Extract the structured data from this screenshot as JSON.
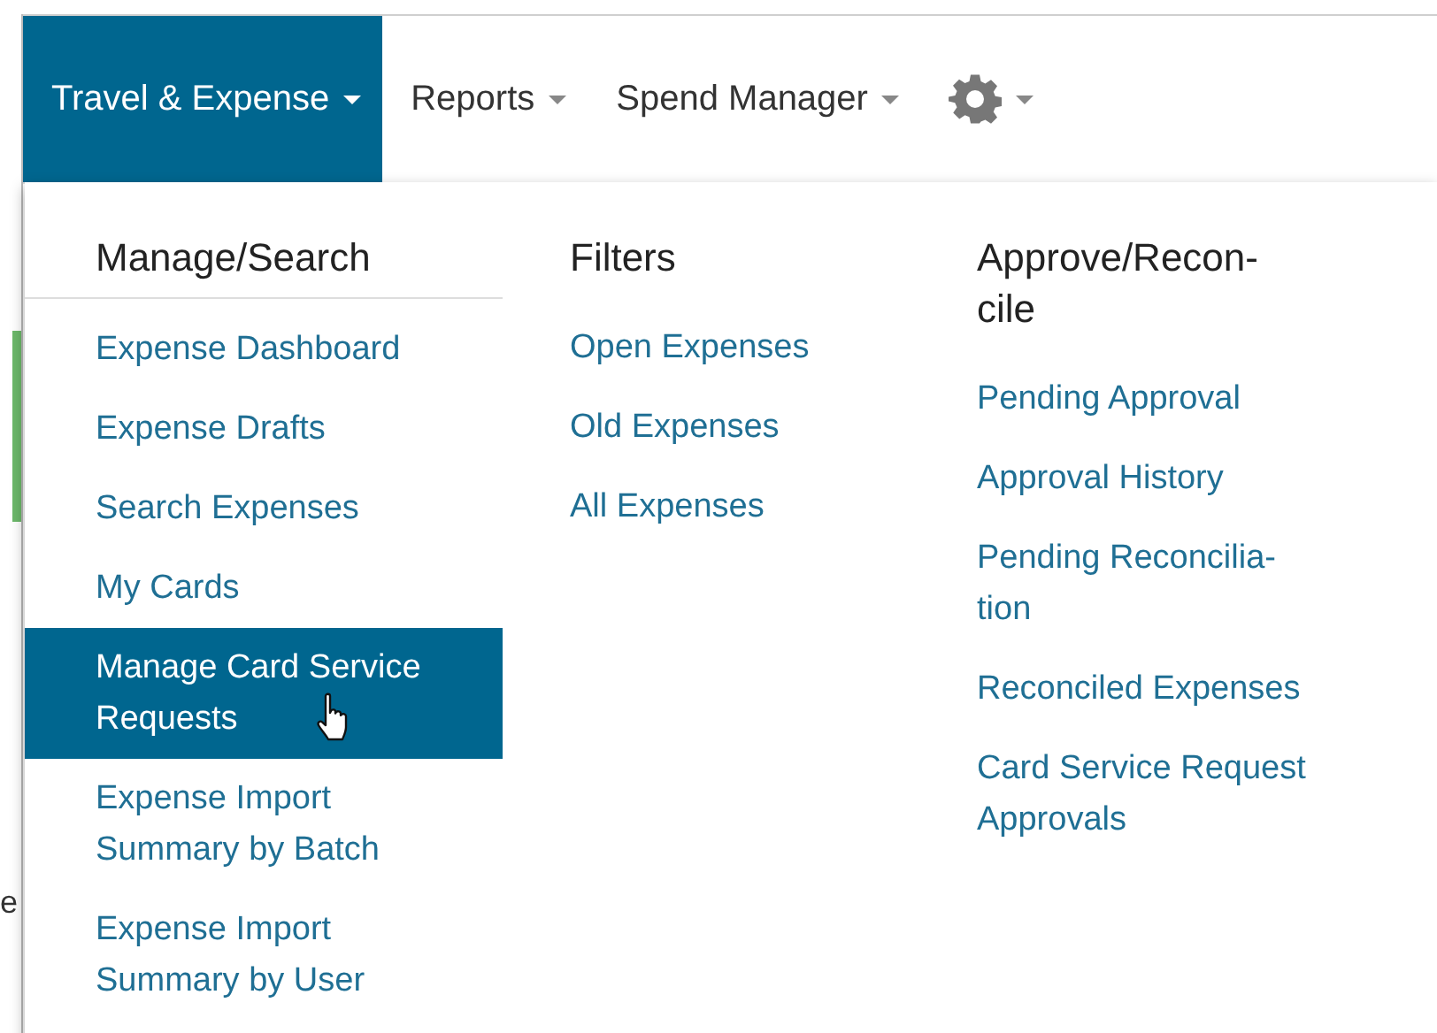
{
  "background": {
    "fragment": "e"
  },
  "nav_tabs": [
    {
      "kind": "text",
      "label": "Travel & Expense",
      "selected": true
    },
    {
      "kind": "text",
      "label": "Reports",
      "selected": false
    },
    {
      "kind": "text",
      "label": "Spend Manager",
      "selected": false
    },
    {
      "kind": "icon",
      "selected": false
    }
  ],
  "menu": {
    "columns": [
      {
        "heading": "Manage/Search",
        "underlined": true,
        "items": [
          {
            "label": "Expense Dashboard",
            "selected": false
          },
          {
            "label": "Expense Drafts",
            "selected": false
          },
          {
            "label": "Search Expenses",
            "selected": false
          },
          {
            "label": "My Cards",
            "selected": false
          },
          {
            "label": "Manage Card Service Requests",
            "selected": true
          },
          {
            "label": "Expense Import Summary by Batch",
            "selected": false
          },
          {
            "label": "Expense Import Summary by User",
            "selected": false
          }
        ]
      },
      {
        "heading": "Filters",
        "underlined": false,
        "items": [
          {
            "label": "Open Expenses",
            "selected": false
          },
          {
            "label": "Old Expenses",
            "selected": false
          },
          {
            "label": "All Expenses",
            "selected": false
          }
        ]
      },
      {
        "heading": "Approve/Recon-cile",
        "underlined": false,
        "items": [
          {
            "label": "Pending Approval",
            "selected": false
          },
          {
            "label": "Approval History",
            "selected": false
          },
          {
            "label": "Pending Reconcilia-tion",
            "selected": false
          },
          {
            "label": "Reconciled Expenses",
            "selected": false
          },
          {
            "label": "Card Service Request Approvals",
            "selected": false
          }
        ]
      }
    ]
  }
}
